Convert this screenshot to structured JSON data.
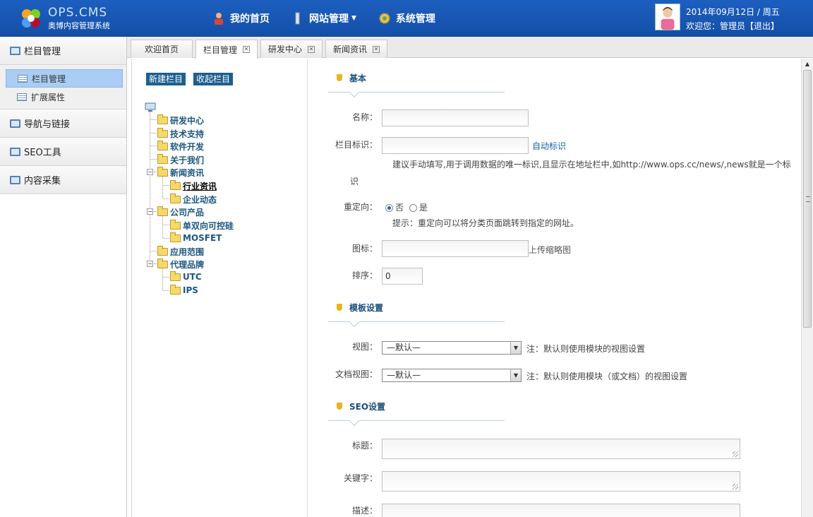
{
  "header": {
    "brand_title": "OPS.CMS",
    "brand_subtitle": "奥博内容管理系统",
    "nav": [
      {
        "label": "我的首页",
        "icon": "home-user-icon"
      },
      {
        "label": "网站管理",
        "icon": "bar-chart-icon",
        "has_dropdown": true
      },
      {
        "label": "系统管理",
        "icon": "gear-icon"
      }
    ],
    "date": "2014年09月12日 / 周五",
    "welcome": "欢迎您：管理员",
    "logout": "【退出】"
  },
  "sidebar": {
    "sections": [
      {
        "label": "栏目管理",
        "icon": "monitor-icon",
        "items": [
          {
            "label": "栏目管理",
            "active": true
          },
          {
            "label": "扩展属性",
            "active": false
          }
        ]
      },
      {
        "label": "导航与链接",
        "icon": "monitor-icon"
      },
      {
        "label": "SEO工具",
        "icon": "monitor-icon"
      },
      {
        "label": "内容采集",
        "icon": "monitor-icon"
      }
    ]
  },
  "tabs": [
    {
      "label": "欢迎首页",
      "closable": false
    },
    {
      "label": "栏目管理",
      "closable": true,
      "active": true
    },
    {
      "label": "研发中心",
      "closable": true
    },
    {
      "label": "新闻资讯",
      "closable": true
    }
  ],
  "tree": {
    "new_button": "新建栏目",
    "collapse_button": "收起栏目",
    "nodes": [
      {
        "label": "研发中心"
      },
      {
        "label": "技术支持"
      },
      {
        "label": "软件开发"
      },
      {
        "label": "关于我们"
      },
      {
        "label": "新闻资讯"
      },
      {
        "label": "行业资讯",
        "selected": true
      },
      {
        "label": "企业动态"
      },
      {
        "label": "公司产品"
      },
      {
        "label": "单双向可控硅"
      },
      {
        "label": "MOSFET"
      },
      {
        "label": "应用范围"
      },
      {
        "label": "代理品牌"
      },
      {
        "label": "UTC"
      },
      {
        "label": "IPS"
      }
    ]
  },
  "form": {
    "basic": {
      "title": "基本",
      "name_label": "名称：",
      "name_value": "",
      "slug_label": "栏目标识：",
      "slug_value": "",
      "auto_slug_link": "自动标识",
      "slug_hint_1": "建议手动填写,用于调用数据的唯一标识,且显示在地址栏中,如http://www.ops.cc/news/,news就是一个标",
      "slug_hint_2": "识",
      "redirect_label": "重定向：",
      "redirect_no": "否",
      "redirect_yes": "是",
      "redirect_selected": "否",
      "redirect_hint": "提示：重定向可以将分类页面跳转到指定的网址。",
      "icon_label": "图标：",
      "icon_value": "",
      "upload_link": "上传缩略图",
      "order_label": "排序：",
      "order_value": "0"
    },
    "template": {
      "title": "模板设置",
      "view_label": "视图：",
      "view_value": "—默认—",
      "view_note": "注：默认则使用模块的视图设置",
      "docview_label": "文档视图：",
      "docview_value": "—默认—",
      "docview_note": "注：默认则使用模块（或文档）的视图设置"
    },
    "seo": {
      "title": "SEO设置",
      "title_label": "标题：",
      "keywords_label": "关键字：",
      "desc_label": "描述："
    }
  },
  "colors": {
    "header_bg": "#1a5ab8",
    "active_item": "#a9cdf4",
    "tree_text": "#1a5780",
    "section_title": "#1a4e7a"
  }
}
